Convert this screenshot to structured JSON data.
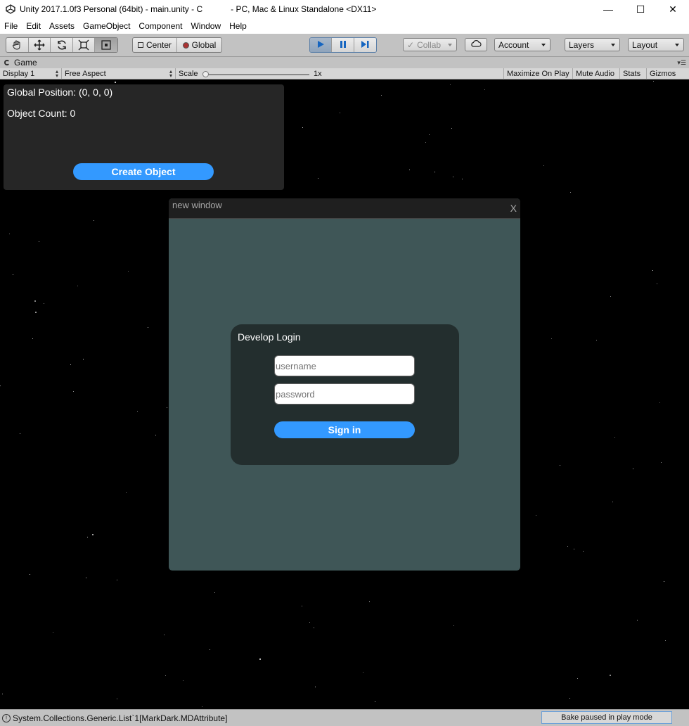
{
  "window": {
    "title": "Unity 2017.1.0f3 Personal (64bit) - main.unity - C            - PC, Mac & Linux Standalone <DX11>",
    "minimize": "—",
    "maximize": "☐",
    "close": "✕"
  },
  "menu": [
    "File",
    "Edit",
    "Assets",
    "GameObject",
    "Component",
    "Window",
    "Help"
  ],
  "toolbar": {
    "pivot": "Center",
    "space": "Global",
    "collab": "Collab",
    "account": "Account",
    "layers": "Layers",
    "layout": "Layout"
  },
  "game_tab": {
    "label": "Game",
    "display": "Display 1",
    "aspect": "Free Aspect",
    "scale_label": "Scale",
    "scale_value": "1x",
    "maximize_on_play": "Maximize On Play",
    "mute_audio": "Mute Audio",
    "stats": "Stats",
    "gizmos": "Gizmos"
  },
  "game": {
    "global_position": "Global Position: (0, 0, 0)",
    "object_count": "Object Count: 0",
    "create_object": "Create Object",
    "new_window": {
      "title": "new window",
      "close": "X",
      "login": {
        "title": "Develop Login",
        "username_placeholder": "username",
        "password_placeholder": "password",
        "sign_in": "Sign in"
      }
    }
  },
  "status": {
    "message": "System.Collections.Generic.List`1[MarkDark.MDAttribute]",
    "bake": "Bake paused in play mode"
  }
}
